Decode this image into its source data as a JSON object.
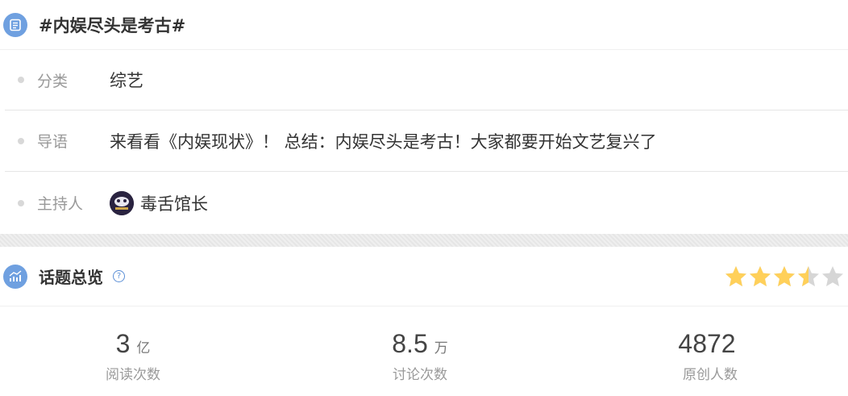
{
  "topic": {
    "title": "#内娱尽头是考古#"
  },
  "details": {
    "category": {
      "label": "分类",
      "value": "综艺"
    },
    "intro": {
      "label": "导语",
      "value": "来看看《内娱现状》！ 总结：内娱尽头是考古！大家都要开始文艺复兴了"
    },
    "host": {
      "label": "主持人",
      "value": "毒舌馆长"
    }
  },
  "overview": {
    "title": "话题总览",
    "help_icon": "?",
    "rating": 3.5,
    "rating_max": 5,
    "star_color": "#ffd05a",
    "star_empty_color": "#d6d6d6"
  },
  "stats": [
    {
      "number": "3",
      "unit": "亿",
      "caption": "阅读次数"
    },
    {
      "number": "8.5",
      "unit": "万",
      "caption": "讨论次数"
    },
    {
      "number": "4872",
      "unit": "",
      "caption": "原创人数"
    }
  ]
}
